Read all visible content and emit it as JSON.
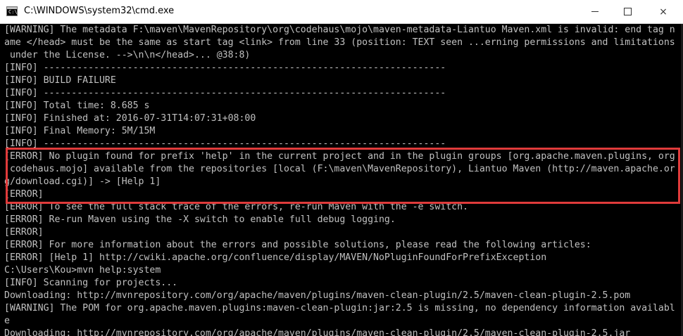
{
  "window": {
    "title": "C:\\WINDOWS\\system32\\cmd.exe",
    "icon_label": "C:\\",
    "controls": {
      "minimize": "minimize",
      "maximize": "maximize",
      "close": "×"
    }
  },
  "console": {
    "lines": [
      "[WARNING] The metadata F:\\maven\\MavenRepository\\org\\codehaus\\mojo\\maven-metadata-Liantuo Maven.xml is invalid: end tag n",
      "ame </head> must be the same as start tag <link> from line 33 (position: TEXT seen ...erning permissions and limitations",
      " under the License. -->\\n\\n</head>... @38:8)",
      "[INFO] ------------------------------------------------------------------------",
      "[INFO] BUILD FAILURE",
      "[INFO] ------------------------------------------------------------------------",
      "[INFO] Total time: 8.685 s",
      "[INFO] Finished at: 2016-07-31T14:07:31+08:00",
      "[INFO] Final Memory: 5M/15M",
      "[INFO] ------------------------------------------------------------------------",
      "[ERROR] No plugin found for prefix 'help' in the current project and in the plugin groups [org.apache.maven.plugins, org",
      ".codehaus.mojo] available from the repositories [local (F:\\maven\\MavenRepository), Liantuo Maven (http://maven.apache.or",
      "g/download.cgi)] -> [Help 1]",
      "[ERROR]",
      "[ERROR] To see the full stack trace of the errors, re-run Maven with the -e switch.",
      "[ERROR] Re-run Maven using the -X switch to enable full debug logging.",
      "[ERROR]",
      "[ERROR] For more information about the errors and possible solutions, please read the following articles:",
      "[ERROR] [Help 1] http://cwiki.apache.org/confluence/display/MAVEN/NoPluginFoundForPrefixException",
      "C:\\Users\\Kou>mvn help:system",
      "[INFO] Scanning for projects...",
      "Downloading: http://mvnrepository.com/org/apache/maven/plugins/maven-clean-plugin/2.5/maven-clean-plugin-2.5.pom",
      "[WARNING] The POM for org.apache.maven.plugins:maven-clean-plugin:jar:2.5 is missing, no dependency information availabl",
      "e",
      "Downloading: http://mvnrepository.com/org/apache/maven/plugins/maven-clean-plugin/2.5/maven-clean-plugin-2.5.jar"
    ]
  },
  "colors": {
    "console_background": "#000000",
    "console_text": "#c0c0c0",
    "highlight_border": "#e03b3b",
    "titlebar_background": "#ffffff"
  }
}
